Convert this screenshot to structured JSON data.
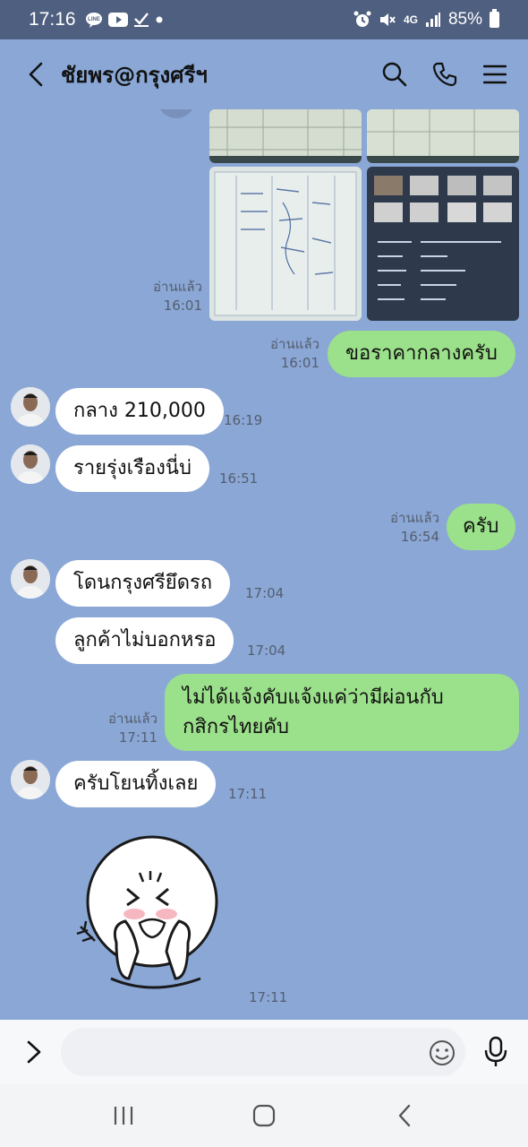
{
  "status_bar": {
    "time": "17:16",
    "network": "4G",
    "battery": "85%",
    "icons": [
      "line-icon",
      "youtube-icon",
      "checkmark-icon",
      "dot-icon",
      "alarm-icon",
      "mute-icon",
      "signal-icon",
      "battery-icon"
    ]
  },
  "header": {
    "title": "ชัยพร@กรุงศรีฯ",
    "icons": [
      "back-icon",
      "search-icon",
      "phone-icon",
      "menu-icon"
    ]
  },
  "colors": {
    "background": "#8aa7d6",
    "outgoing_bubble": "#9be08a",
    "incoming_bubble": "#ffffff",
    "status_bar": "#4f5f7f"
  },
  "photo_message": {
    "read_label": "อ่านแล้ว",
    "time": "16:01"
  },
  "messages": [
    {
      "direction": "out",
      "text": "ขอราคากลางครับ",
      "read_label": "อ่านแล้ว",
      "time": "16:01"
    },
    {
      "direction": "in",
      "text": "กลาง 210,000",
      "time": "16:19"
    },
    {
      "direction": "in",
      "text": "รายรุ่งเรืองนี่บ่",
      "time": "16:51"
    },
    {
      "direction": "out",
      "text": "ครับ",
      "read_label": "อ่านแล้ว",
      "time": "16:54"
    },
    {
      "direction": "in",
      "text": "โดนกรุงศรียึดรถ",
      "time": "17:04"
    },
    {
      "direction": "in",
      "text": "ลูกค้าไม่บอกหรอ",
      "time": "17:04"
    },
    {
      "direction": "out",
      "lines": [
        "ไม่ได้แจ้งคับแจ้งแค่ว่ามีผ่อนกับ",
        "กสิกรไทยคับ"
      ],
      "read_label": "อ่านแล้ว",
      "time": "17:11"
    },
    {
      "direction": "in",
      "text": "ครับโยนทิ้งเลย",
      "time": "17:11"
    },
    {
      "direction": "in",
      "sticker": "laughing-face-sticker",
      "time": "17:11"
    }
  ],
  "input": {
    "placeholder": ""
  },
  "nav": {
    "icons": [
      "recent-apps-icon",
      "home-icon",
      "back-nav-icon"
    ]
  }
}
